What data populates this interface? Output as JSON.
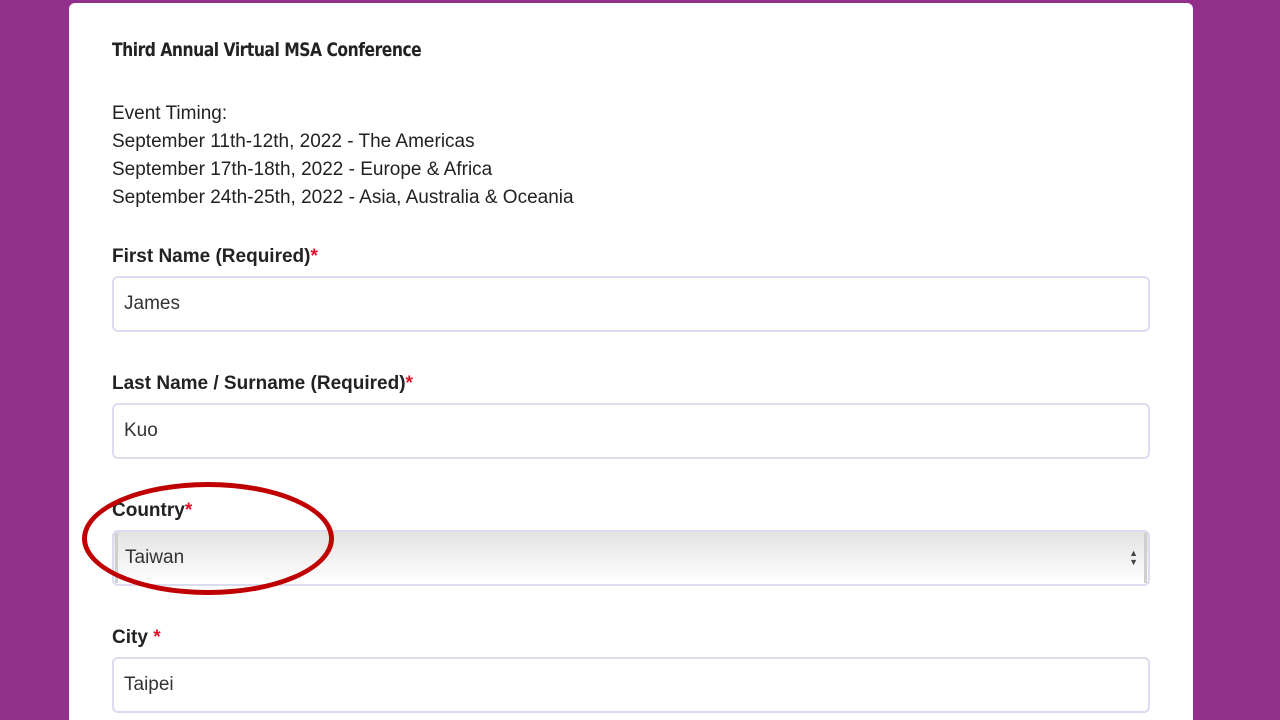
{
  "form": {
    "title": "Third Annual Virtual MSA Conference",
    "timing": [
      "Event Timing:",
      "September 11th-12th, 2022 - The Americas",
      "September 17th-18th, 2022 - Europe & Africa",
      "September 24th-25th, 2022 - Asia, Australia & Oceania"
    ],
    "required_mark": "*",
    "first_name": {
      "label": "First Name (Required)",
      "value": "James"
    },
    "last_name": {
      "label": "Last Name / Surname (Required)",
      "value": "Kuo"
    },
    "country": {
      "label": "Country",
      "value": "Taiwan"
    },
    "city": {
      "label": "City ",
      "value": "Taipei"
    }
  },
  "select_arrows": {
    "up": "▲",
    "down": "▼"
  },
  "icons": {
    "select": "select-arrows-icon"
  },
  "colors": {
    "background": "#912f8a",
    "required": "#e0102a",
    "annotation": "#c00000",
    "input_border": "#dcdcf0"
  }
}
